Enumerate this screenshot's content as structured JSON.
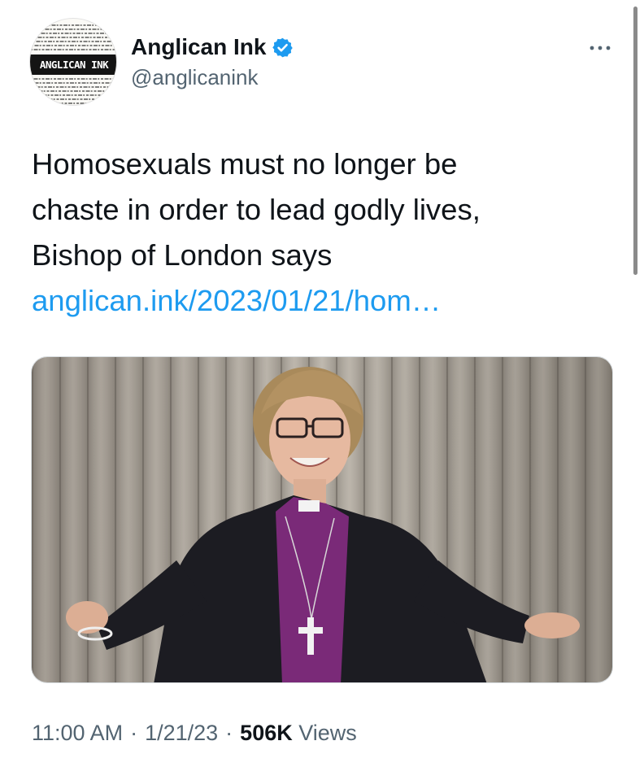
{
  "author": {
    "display_name": "Anglican Ink",
    "handle": "@anglicanink",
    "avatar_logo_text": "ANGLICAN INK",
    "verified": true
  },
  "tweet": {
    "text_lines": [
      "Homosexuals must no longer be",
      "chaste in order to lead godly lives,",
      "Bishop of London says"
    ],
    "link_text": "anglican.ink/2023/01/21/hom…"
  },
  "meta": {
    "time": "11:00 AM",
    "separator": "·",
    "date": "1/21/23",
    "views_count": "506K",
    "views_label": "Views"
  },
  "icons": {
    "verified": "verified-badge-icon",
    "more": "more-options-icon"
  },
  "colors": {
    "link": "#1d9bf0",
    "verified": "#1d9bf0",
    "secondary_text": "#536471",
    "primary_text": "#0f1419"
  }
}
